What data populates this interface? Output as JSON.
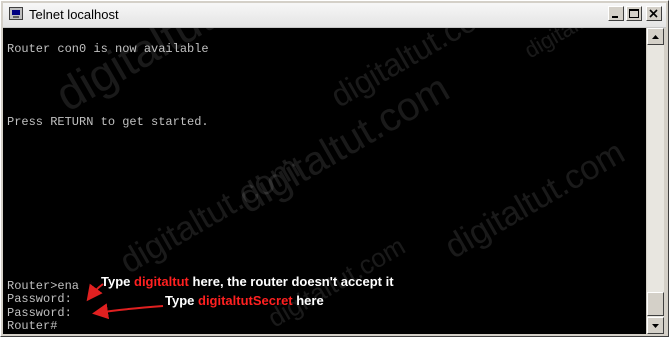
{
  "window": {
    "title": "Telnet localhost",
    "icons": {
      "app": "telnet-app-icon",
      "minimize": "minimize-icon",
      "maximize": "maximize-icon",
      "close": "close-icon"
    }
  },
  "terminal": {
    "lines": [
      "Router con0 is now available",
      "Press RETURN to get started.",
      "Router>ena",
      "Password:",
      "Password:",
      "Router#"
    ],
    "text_color": "#c0c0c0",
    "background_color": "#000000"
  },
  "annotations": [
    {
      "prefix": "Type ",
      "highlight": "digitaltut",
      "suffix": " here, the router doesn't accept it"
    },
    {
      "prefix": "Type ",
      "highlight": "digitaltutSecret",
      "suffix": " here"
    }
  ],
  "annotation_colors": {
    "text": "#ffffff",
    "highlight": "#ff2020",
    "arrow": "#e02020"
  },
  "watermark": {
    "text": "digitaltut.com"
  },
  "scrollbar": {
    "icons": {
      "up": "scroll-up-arrow-icon",
      "down": "scroll-down-arrow-icon"
    }
  }
}
